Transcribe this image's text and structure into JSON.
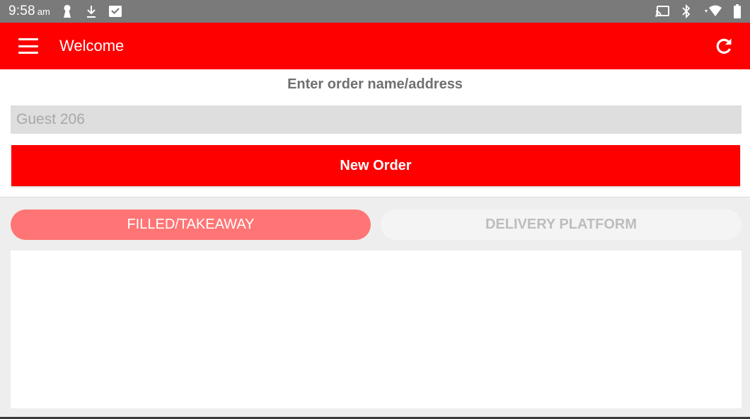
{
  "status_bar": {
    "time": "9:58",
    "ampm": "am",
    "left_icons": [
      "keyhole-icon",
      "download-icon",
      "inbox-check-icon"
    ],
    "right_icons": [
      "cast-icon",
      "bluetooth-icon",
      "wifi-icon",
      "battery-icon"
    ]
  },
  "app_bar": {
    "title": "Welcome",
    "menu_icon": "hamburger-menu-icon",
    "refresh_icon": "refresh-icon",
    "color": "#ff0000"
  },
  "order_form": {
    "label": "Enter order name/address",
    "input_placeholder": "Guest 206",
    "input_value": "",
    "button_label": "New Order"
  },
  "tabs": [
    {
      "label": "FILLED/TAKEAWAY",
      "selected": true
    },
    {
      "label": "DELIVERY PLATFORM",
      "selected": false
    }
  ],
  "orders": []
}
